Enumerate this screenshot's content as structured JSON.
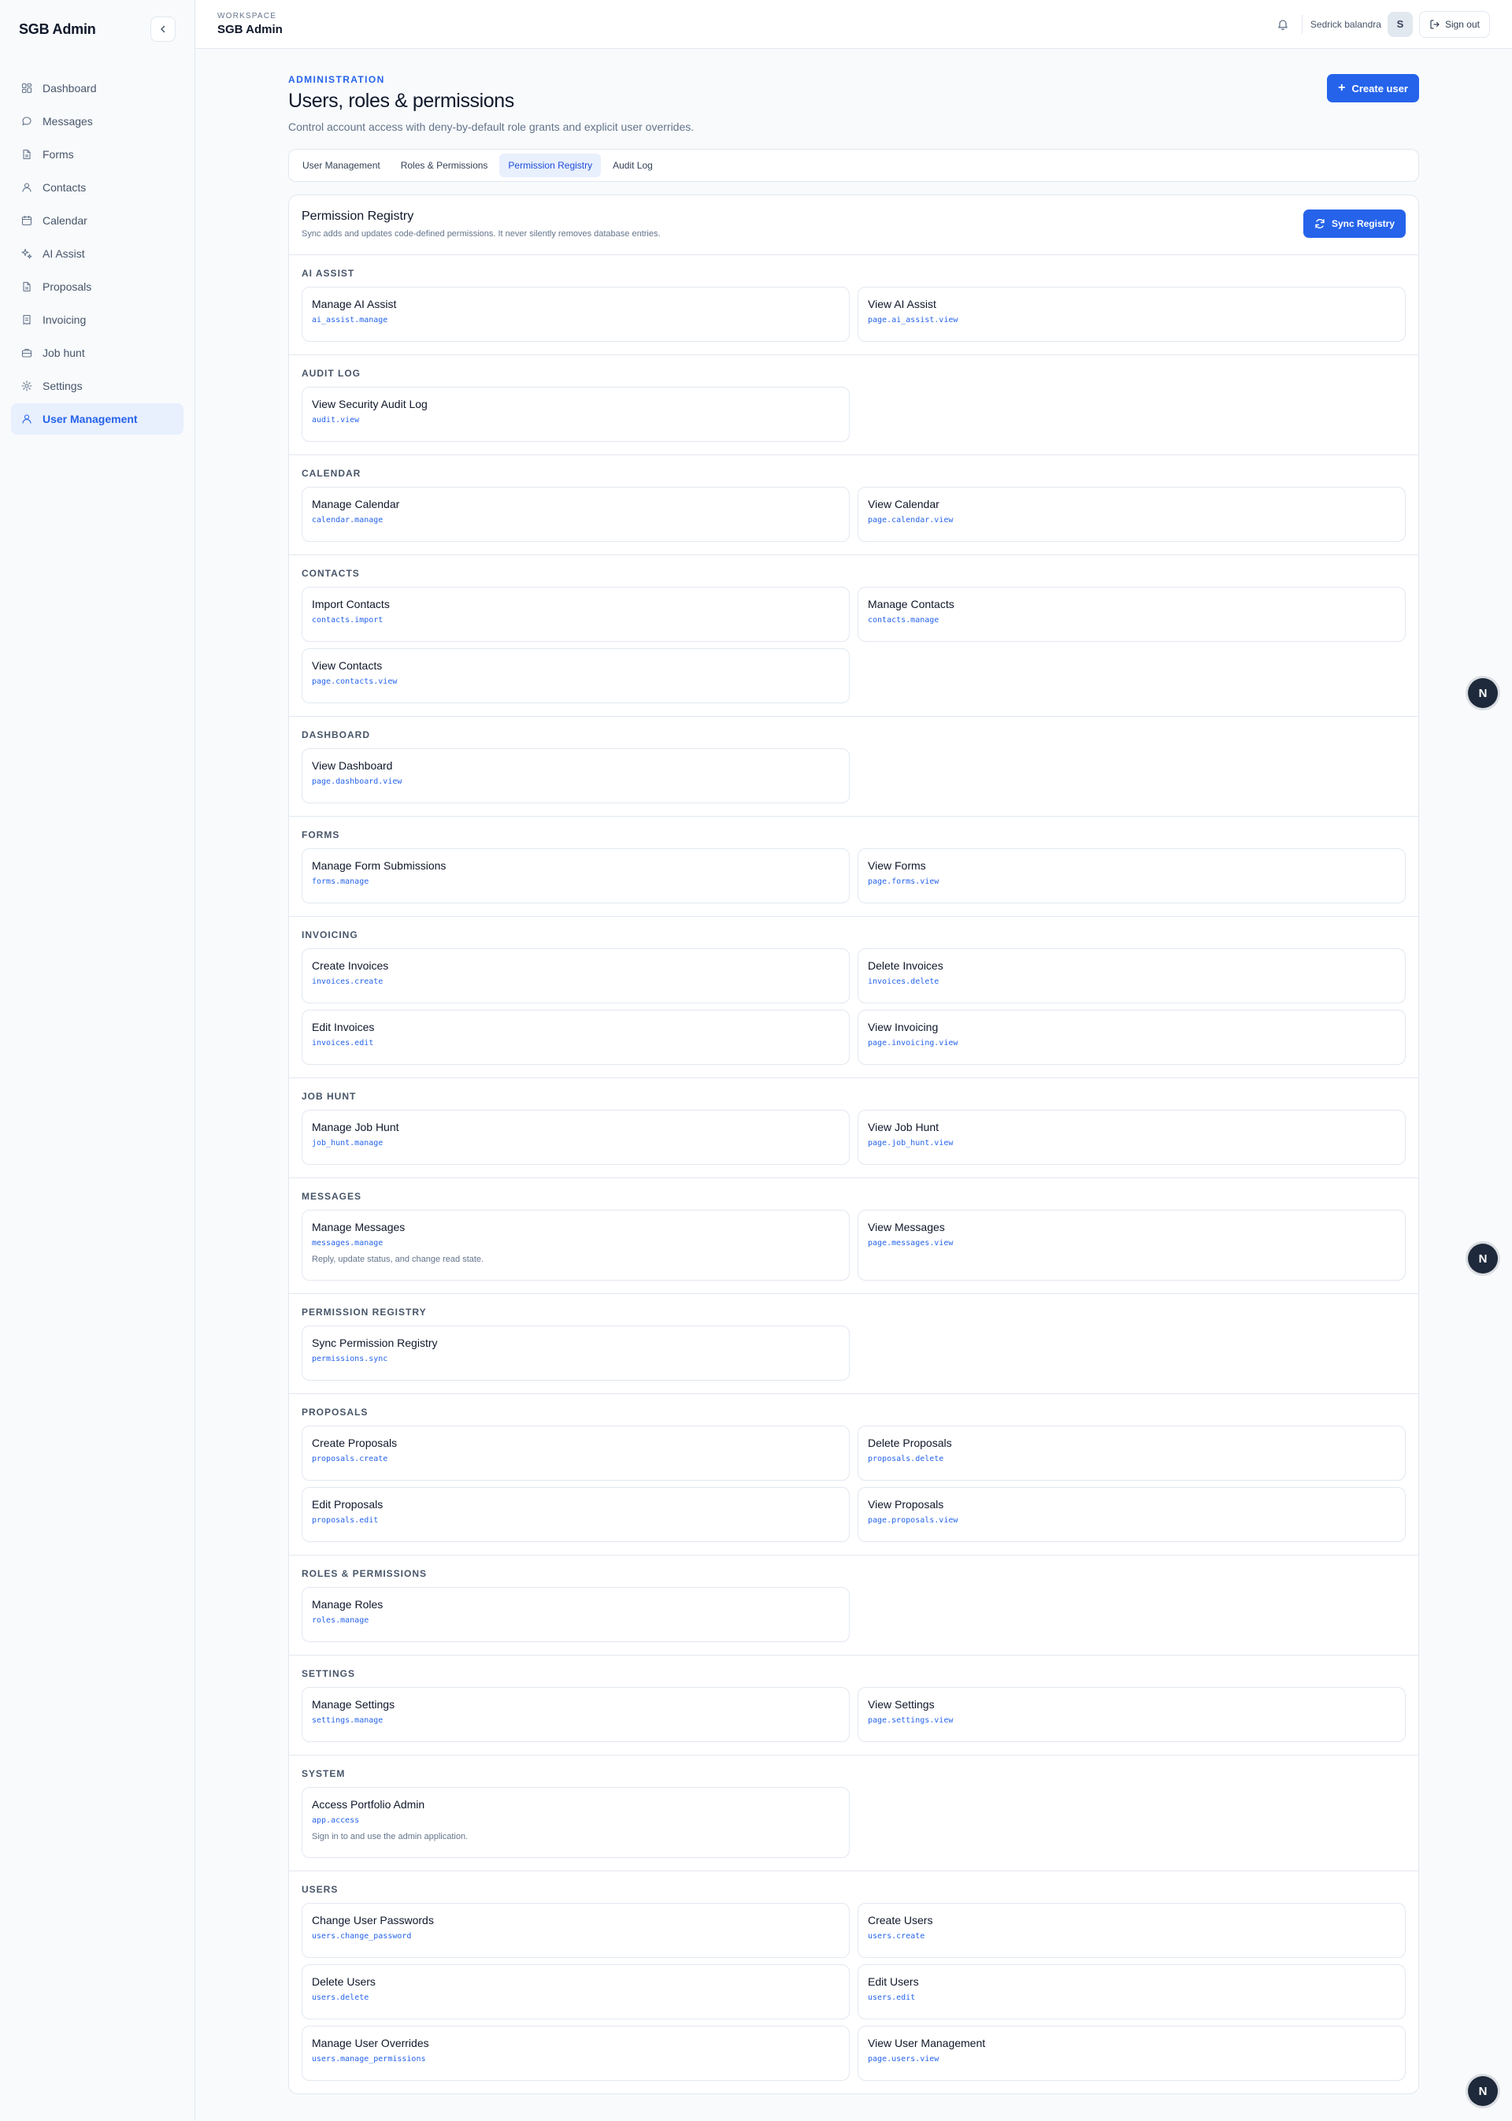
{
  "sidebar": {
    "brand": "SGB Admin",
    "items": [
      {
        "label": "Dashboard",
        "icon": "dashboard-icon"
      },
      {
        "label": "Messages",
        "icon": "message-icon"
      },
      {
        "label": "Forms",
        "icon": "file-icon"
      },
      {
        "label": "Contacts",
        "icon": "user-icon"
      },
      {
        "label": "Calendar",
        "icon": "calendar-icon"
      },
      {
        "label": "AI Assist",
        "icon": "sparkle-icon"
      },
      {
        "label": "Proposals",
        "icon": "file-icon"
      },
      {
        "label": "Invoicing",
        "icon": "receipt-icon"
      },
      {
        "label": "Job hunt",
        "icon": "briefcase-icon"
      },
      {
        "label": "Settings",
        "icon": "gear-icon"
      },
      {
        "label": "User Management",
        "icon": "user-icon",
        "active": true
      }
    ]
  },
  "topbar": {
    "workspace_label": "WORKSPACE",
    "workspace_name": "SGB Admin",
    "user_name": "Sedrick balandra",
    "avatar_initial": "S",
    "signout_label": "Sign out"
  },
  "header": {
    "eyebrow": "ADMINISTRATION",
    "title": "Users, roles & permissions",
    "subtitle": "Control account access with deny-by-default role grants and explicit user overrides.",
    "create_label": "Create user"
  },
  "tabs": [
    {
      "label": "User Management"
    },
    {
      "label": "Roles & Permissions"
    },
    {
      "label": "Permission Registry",
      "active": true
    },
    {
      "label": "Audit Log"
    }
  ],
  "registry": {
    "title": "Permission Registry",
    "subtitle": "Sync adds and updates code-defined permissions. It never silently removes database entries.",
    "sync_label": "Sync Registry",
    "groups": [
      {
        "title": "AI ASSIST",
        "items": [
          {
            "name": "Manage AI Assist",
            "key": "ai_assist.manage"
          },
          {
            "name": "View AI Assist",
            "key": "page.ai_assist.view"
          }
        ]
      },
      {
        "title": "AUDIT LOG",
        "items": [
          {
            "name": "View Security Audit Log",
            "key": "audit.view"
          }
        ]
      },
      {
        "title": "CALENDAR",
        "items": [
          {
            "name": "Manage Calendar",
            "key": "calendar.manage"
          },
          {
            "name": "View Calendar",
            "key": "page.calendar.view"
          }
        ]
      },
      {
        "title": "CONTACTS",
        "items": [
          {
            "name": "Import Contacts",
            "key": "contacts.import"
          },
          {
            "name": "Manage Contacts",
            "key": "contacts.manage"
          },
          {
            "name": "View Contacts",
            "key": "page.contacts.view"
          }
        ]
      },
      {
        "title": "DASHBOARD",
        "items": [
          {
            "name": "View Dashboard",
            "key": "page.dashboard.view"
          }
        ]
      },
      {
        "title": "FORMS",
        "items": [
          {
            "name": "Manage Form Submissions",
            "key": "forms.manage"
          },
          {
            "name": "View Forms",
            "key": "page.forms.view"
          }
        ]
      },
      {
        "title": "INVOICING",
        "items": [
          {
            "name": "Create Invoices",
            "key": "invoices.create"
          },
          {
            "name": "Delete Invoices",
            "key": "invoices.delete"
          },
          {
            "name": "Edit Invoices",
            "key": "invoices.edit"
          },
          {
            "name": "View Invoicing",
            "key": "page.invoicing.view"
          }
        ]
      },
      {
        "title": "JOB HUNT",
        "items": [
          {
            "name": "Manage Job Hunt",
            "key": "job_hunt.manage"
          },
          {
            "name": "View Job Hunt",
            "key": "page.job_hunt.view"
          }
        ]
      },
      {
        "title": "MESSAGES",
        "items": [
          {
            "name": "Manage Messages",
            "key": "messages.manage",
            "desc": "Reply, update status, and change read state."
          },
          {
            "name": "View Messages",
            "key": "page.messages.view"
          }
        ]
      },
      {
        "title": "PERMISSION REGISTRY",
        "items": [
          {
            "name": "Sync Permission Registry",
            "key": "permissions.sync"
          }
        ]
      },
      {
        "title": "PROPOSALS",
        "items": [
          {
            "name": "Create Proposals",
            "key": "proposals.create"
          },
          {
            "name": "Delete Proposals",
            "key": "proposals.delete"
          },
          {
            "name": "Edit Proposals",
            "key": "proposals.edit"
          },
          {
            "name": "View Proposals",
            "key": "page.proposals.view"
          }
        ]
      },
      {
        "title": "ROLES & PERMISSIONS",
        "items": [
          {
            "name": "Manage Roles",
            "key": "roles.manage"
          }
        ]
      },
      {
        "title": "SETTINGS",
        "items": [
          {
            "name": "Manage Settings",
            "key": "settings.manage"
          },
          {
            "name": "View Settings",
            "key": "page.settings.view"
          }
        ]
      },
      {
        "title": "SYSTEM",
        "items": [
          {
            "name": "Access Portfolio Admin",
            "key": "app.access",
            "desc": "Sign in to and use the admin application."
          }
        ]
      },
      {
        "title": "USERS",
        "items": [
          {
            "name": "Change User Passwords",
            "key": "users.change_password"
          },
          {
            "name": "Create Users",
            "key": "users.create"
          },
          {
            "name": "Delete Users",
            "key": "users.delete"
          },
          {
            "name": "Edit Users",
            "key": "users.edit"
          },
          {
            "name": "Manage User Overrides",
            "key": "users.manage_permissions"
          },
          {
            "name": "View User Management",
            "key": "page.users.view"
          }
        ]
      }
    ]
  },
  "fab_label": "N"
}
